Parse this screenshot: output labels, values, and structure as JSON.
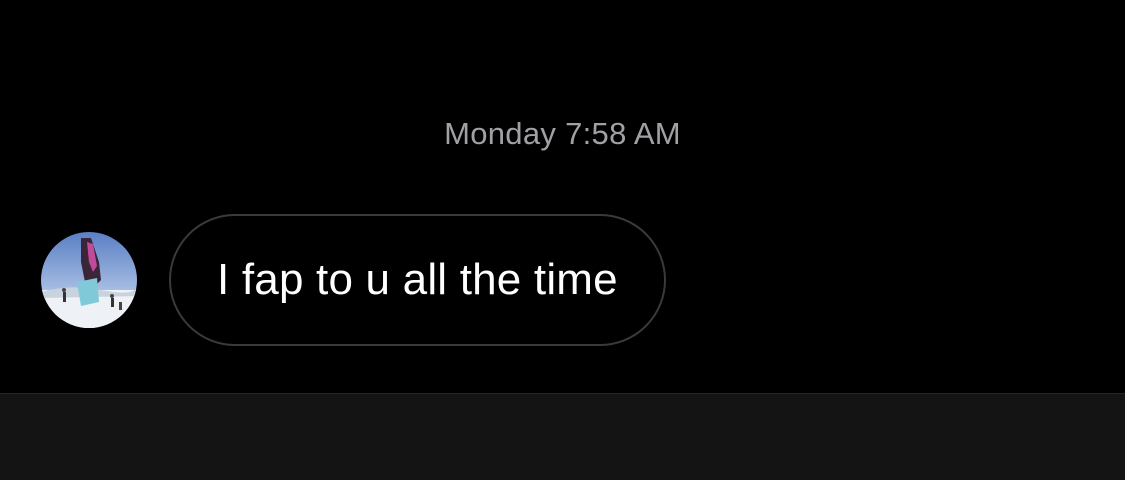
{
  "thread": {
    "timestamp": "Monday 7:58 AM",
    "messages": [
      {
        "direction": "incoming",
        "text": "I fap to u all the time"
      }
    ]
  },
  "colors": {
    "background": "#000000",
    "bubble_border": "#3a3a3c",
    "timestamp_text": "#a0a0a5",
    "composer_background": "#141414"
  }
}
